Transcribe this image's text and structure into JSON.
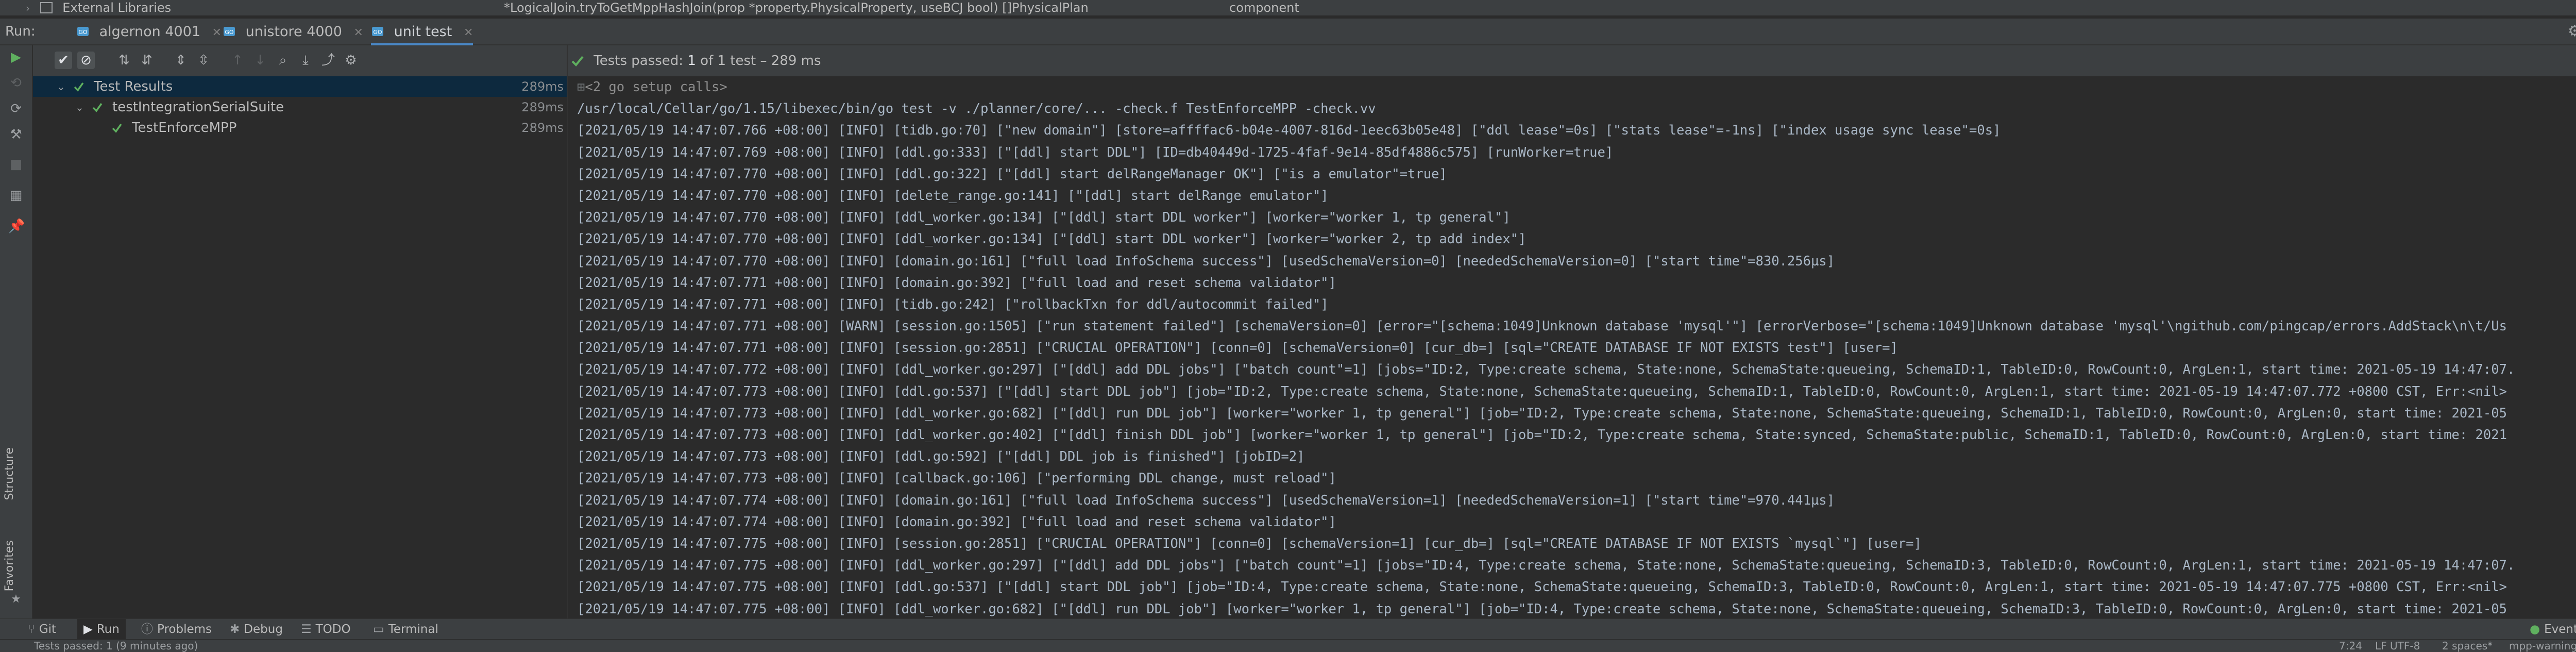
{
  "topbar": {
    "external_libraries": "External Libraries",
    "method_signature": "*LogicalJoin.tryToGetMppHashJoin(prop *property.PhysicalProperty, useBCJ bool) []PhysicalPlan",
    "component": "component"
  },
  "run_bar": {
    "label": "Run:",
    "tabs": [
      {
        "label": "algernon 4001"
      },
      {
        "label": "unistore 4000"
      },
      {
        "label": "unit test"
      }
    ]
  },
  "test_tree": {
    "rows": [
      {
        "name": "Test Results",
        "time": "289ms"
      },
      {
        "name": "testIntegrationSerialSuite",
        "time": "289ms"
      },
      {
        "name": "TestEnforceMPP",
        "time": "289ms"
      }
    ]
  },
  "console": {
    "status_prefix": "Tests passed:",
    "status_count": "1",
    "status_suffix": "of 1 test – 289 ms",
    "fold_label": "<2 go setup calls>",
    "lines": [
      "/usr/local/Cellar/go/1.15/libexec/bin/go test -v ./planner/core/... -check.f TestEnforceMPP -check.vv",
      "[2021/05/19 14:47:07.766 +08:00] [INFO] [tidb.go:70] [\"new domain\"] [store=affffac6-b04e-4007-816d-1eec63b05e48] [\"ddl lease\"=0s] [\"stats lease\"=-1ns] [\"index usage sync lease\"=0s]",
      "[2021/05/19 14:47:07.769 +08:00] [INFO] [ddl.go:333] [\"[ddl] start DDL\"] [ID=db40449d-1725-4faf-9e14-85df4886c575] [runWorker=true]",
      "[2021/05/19 14:47:07.770 +08:00] [INFO] [ddl.go:322] [\"[ddl] start delRangeManager OK\"] [\"is a emulator\"=true]",
      "[2021/05/19 14:47:07.770 +08:00] [INFO] [delete_range.go:141] [\"[ddl] start delRange emulator\"]",
      "[2021/05/19 14:47:07.770 +08:00] [INFO] [ddl_worker.go:134] [\"[ddl] start DDL worker\"] [worker=\"worker 1, tp general\"]",
      "[2021/05/19 14:47:07.770 +08:00] [INFO] [ddl_worker.go:134] [\"[ddl] start DDL worker\"] [worker=\"worker 2, tp add index\"]",
      "[2021/05/19 14:47:07.770 +08:00] [INFO] [domain.go:161] [\"full load InfoSchema success\"] [usedSchemaVersion=0] [neededSchemaVersion=0] [\"start time\"=830.256µs]",
      "[2021/05/19 14:47:07.771 +08:00] [INFO] [domain.go:392] [\"full load and reset schema validator\"]",
      "[2021/05/19 14:47:07.771 +08:00] [INFO] [tidb.go:242] [\"rollbackTxn for ddl/autocommit failed\"]",
      "[2021/05/19 14:47:07.771 +08:00] [WARN] [session.go:1505] [\"run statement failed\"] [schemaVersion=0] [error=\"[schema:1049]Unknown database 'mysql'\"] [errorVerbose=\"[schema:1049]Unknown database 'mysql'\\ngithub.com/pingcap/errors.AddStack\\n\\t/Us",
      "[2021/05/19 14:47:07.771 +08:00] [INFO] [session.go:2851] [\"CRUCIAL OPERATION\"] [conn=0] [schemaVersion=0] [cur_db=] [sql=\"CREATE DATABASE IF NOT EXISTS test\"] [user=]",
      "[2021/05/19 14:47:07.772 +08:00] [INFO] [ddl_worker.go:297] [\"[ddl] add DDL jobs\"] [\"batch count\"=1] [jobs=\"ID:2, Type:create schema, State:none, SchemaState:queueing, SchemaID:1, TableID:0, RowCount:0, ArgLen:1, start time: 2021-05-19 14:47:07.",
      "[2021/05/19 14:47:07.773 +08:00] [INFO] [ddl.go:537] [\"[ddl] start DDL job\"] [job=\"ID:2, Type:create schema, State:none, SchemaState:queueing, SchemaID:1, TableID:0, RowCount:0, ArgLen:1, start time: 2021-05-19 14:47:07.772 +0800 CST, Err:<nil>",
      "[2021/05/19 14:47:07.773 +08:00] [INFO] [ddl_worker.go:682] [\"[ddl] run DDL job\"] [worker=\"worker 1, tp general\"] [job=\"ID:2, Type:create schema, State:none, SchemaState:queueing, SchemaID:1, TableID:0, RowCount:0, ArgLen:0, start time: 2021-05",
      "[2021/05/19 14:47:07.773 +08:00] [INFO] [ddl_worker.go:402] [\"[ddl] finish DDL job\"] [worker=\"worker 1, tp general\"] [job=\"ID:2, Type:create schema, State:synced, SchemaState:public, SchemaID:1, TableID:0, RowCount:0, ArgLen:0, start time: 2021",
      "[2021/05/19 14:47:07.773 +08:00] [INFO] [ddl.go:592] [\"[ddl] DDL job is finished\"] [jobID=2]",
      "[2021/05/19 14:47:07.773 +08:00] [INFO] [callback.go:106] [\"performing DDL change, must reload\"]",
      "[2021/05/19 14:47:07.774 +08:00] [INFO] [domain.go:161] [\"full load InfoSchema success\"] [usedSchemaVersion=1] [neededSchemaVersion=1] [\"start time\"=970.441µs]",
      "[2021/05/19 14:47:07.774 +08:00] [INFO] [domain.go:392] [\"full load and reset schema validator\"]",
      "[2021/05/19 14:47:07.775 +08:00] [INFO] [session.go:2851] [\"CRUCIAL OPERATION\"] [conn=0] [schemaVersion=1] [cur_db=] [sql=\"CREATE DATABASE IF NOT EXISTS `mysql`\"] [user=]",
      "[2021/05/19 14:47:07.775 +08:00] [INFO] [ddl_worker.go:297] [\"[ddl] add DDL jobs\"] [\"batch count\"=1] [jobs=\"ID:4, Type:create schema, State:none, SchemaState:queueing, SchemaID:3, TableID:0, RowCount:0, ArgLen:1, start time: 2021-05-19 14:47:07.",
      "[2021/05/19 14:47:07.775 +08:00] [INFO] [ddl.go:537] [\"[ddl] start DDL job\"] [job=\"ID:4, Type:create schema, State:none, SchemaState:queueing, SchemaID:3, TableID:0, RowCount:0, ArgLen:1, start time: 2021-05-19 14:47:07.775 +0800 CST, Err:<nil>",
      "[2021/05/19 14:47:07.775 +08:00] [INFO] [ddl_worker.go:682] [\"[ddl] run DDL job\"] [worker=\"worker 1, tp general\"] [job=\"ID:4, Type:create schema, State:none, SchemaState:queueing, SchemaID:3, TableID:0, RowCount:0, ArgLen:0, start time: 2021-05"
    ]
  },
  "left_stripe": {
    "structure": "Structure",
    "favorites": "Favorites"
  },
  "bottom_tabs": [
    {
      "label": "Git",
      "icon": "git-branch-icon"
    },
    {
      "label": "Run",
      "icon": "play-icon"
    },
    {
      "label": "Problems",
      "icon": "info-icon"
    },
    {
      "label": "Debug",
      "icon": "bug-icon"
    },
    {
      "label": "TODO",
      "icon": "list-icon"
    },
    {
      "label": "Terminal",
      "icon": "terminal-icon"
    }
  ],
  "event_log": "Event Log",
  "status_bar": {
    "message": "Tests passed: 1 (9 minutes ago)",
    "position": "7:24",
    "encoding": "LF  UTF-8",
    "indent": "2 spaces*",
    "branch": "mpp-warnings"
  },
  "colors": {
    "pass_green": "#5fb05f",
    "accent_blue": "#4a88c7",
    "panel_bg": "#3c3f41",
    "editor_bg": "#2b2b2b"
  }
}
